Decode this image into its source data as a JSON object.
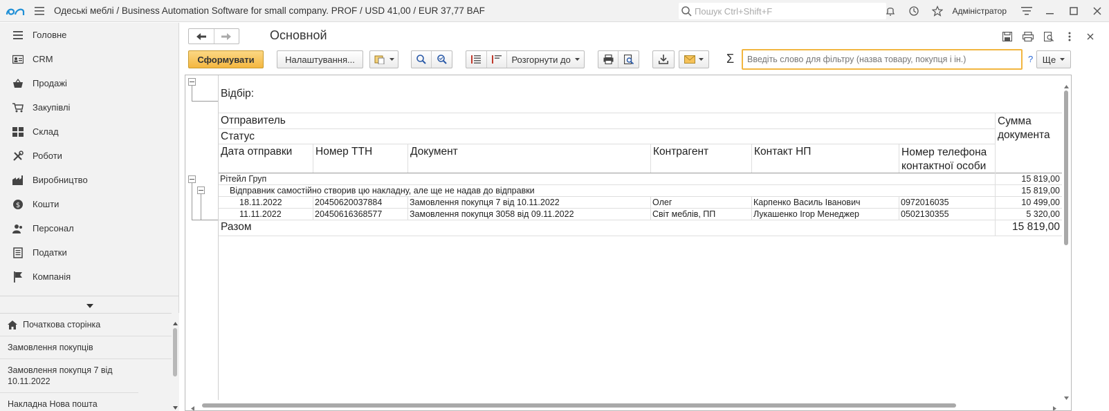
{
  "topbar": {
    "title": "Одеські меблі / Business Automation Software for small company. PROF / USD 41,00 / EUR 37,77 BAF",
    "search_placeholder": "Пошук Ctrl+Shift+F",
    "user": "Адміністратор"
  },
  "sidebar": {
    "items": [
      {
        "label": "Головне",
        "icon": "menu-lines-icon"
      },
      {
        "label": "CRM",
        "icon": "contact-card-icon"
      },
      {
        "label": "Продажі",
        "icon": "basket-icon"
      },
      {
        "label": "Закупівлі",
        "icon": "cart-icon"
      },
      {
        "label": "Склад",
        "icon": "warehouse-icon"
      },
      {
        "label": "Роботи",
        "icon": "tools-icon"
      },
      {
        "label": "Виробництво",
        "icon": "factory-icon"
      },
      {
        "label": "Кошти",
        "icon": "money-icon"
      },
      {
        "label": "Персонал",
        "icon": "people-icon"
      },
      {
        "label": "Податки",
        "icon": "document-icon"
      },
      {
        "label": "Компанія",
        "icon": "flag-icon"
      }
    ],
    "history": [
      {
        "label": "Початкова сторінка"
      },
      {
        "label": "Замовлення покупців"
      },
      {
        "label": "Замовлення покупця 7 від 10.11.2022"
      },
      {
        "label": "Накладна Нова пошта"
      }
    ]
  },
  "form": {
    "title": "Основной"
  },
  "toolbar": {
    "generate": "Сформувати",
    "settings": "Налаштування...",
    "expand_to": "Розгорнути до",
    "filter_placeholder": "Введіть слово для фільтру (назва товару, покупця і ін.)",
    "help": "?",
    "more": "Ще"
  },
  "report": {
    "selection_label": "Відбір:",
    "header": {
      "sender": "Отправитель",
      "status": "Статус",
      "sum": "Сумма документа",
      "date": "Дата отправки",
      "ttn": "Номер ТТН",
      "document": "Документ",
      "counterparty": "Контрагент",
      "contact": "Контакт НП",
      "phone": "Номер телефона контактної особи"
    },
    "group": {
      "name": "Рітейл Груп",
      "sum": "15 819,00"
    },
    "subgroup": {
      "name": "Відправник самостійно створив цю накладну, але ще не надав до відправки",
      "sum": "15 819,00"
    },
    "rows": [
      {
        "date": "18.11.2022",
        "ttn": "20450620037884",
        "document": "Замовлення покупця 7 від 10.11.2022",
        "counterparty": "Олег",
        "contact": "Карпенко Василь Іванович",
        "phone": "0972016035",
        "sum": "10 499,00"
      },
      {
        "date": "11.11.2022",
        "ttn": "20450616368577",
        "document": "Замовлення покупця 3058 від 09.11.2022",
        "counterparty": "Світ меблів, ПП",
        "contact": "Лукашенко Ігор Менеджер",
        "phone": "0502130355",
        "sum": "5 320,00"
      }
    ],
    "total_label": "Разом",
    "total_sum": "15 819,00"
  },
  "colors": {
    "accent_button": "#f4b740",
    "logo_blue": "#1f8fd6",
    "filter_border": "#f2b53f"
  }
}
